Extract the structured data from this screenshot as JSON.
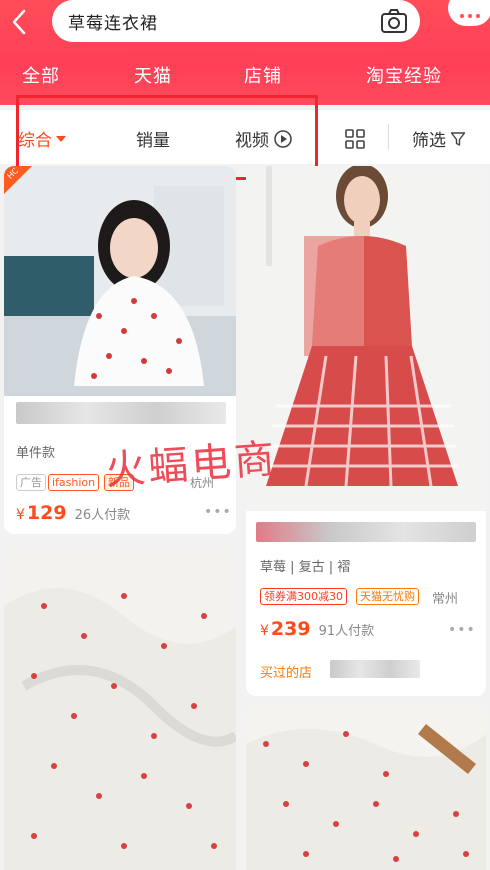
{
  "header": {
    "search_query": "草莓连衣裙",
    "tabs": [
      "全部",
      "天猫",
      "店铺",
      "淘宝经验"
    ]
  },
  "sortbar": {
    "items": [
      "综合",
      "销量",
      "视频",
      "筛选"
    ]
  },
  "products": [
    {
      "attrs": "单件款",
      "tags": [
        "广告",
        "ifashion",
        "新品"
      ],
      "location": "杭州",
      "price_symbol": "¥",
      "price": "129",
      "sold": "26人付款",
      "corner_badge": "HC"
    },
    {
      "attrs": "草莓 | 复古 | 褶",
      "tags": [
        "领券满300减30",
        "天猫无忧购"
      ],
      "location": "常州",
      "price_symbol": "¥",
      "price": "239",
      "sold": "91人付款",
      "bought_label": "买过的店"
    }
  ],
  "watermark": "火蝠电商",
  "colors": {
    "header_red": "#ff4d58",
    "price_orange": "#ff4a1c",
    "highlight_red": "#f0262f"
  }
}
